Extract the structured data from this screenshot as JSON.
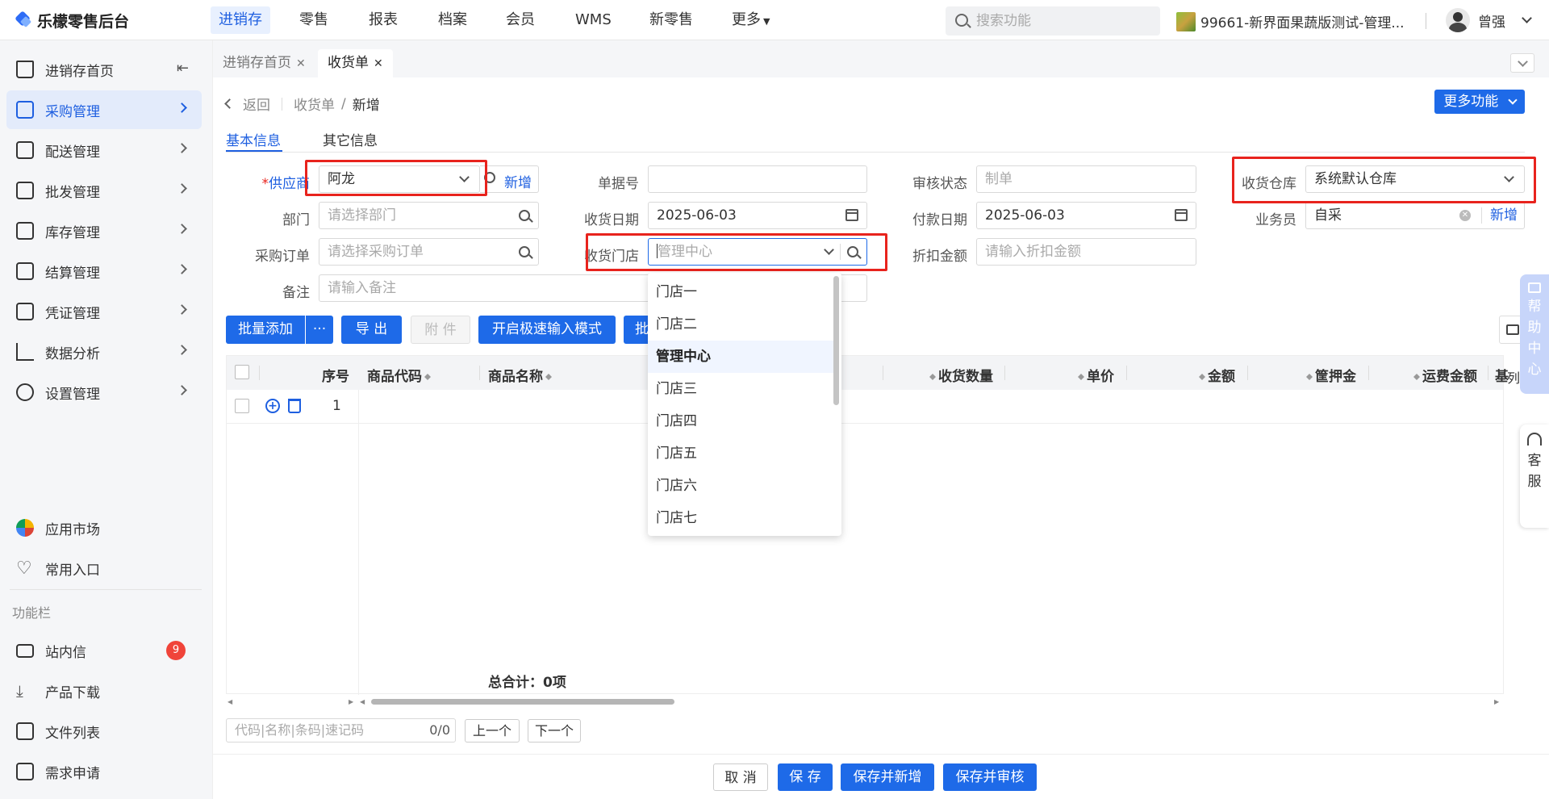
{
  "app": {
    "title": "乐檬零售后台"
  },
  "topnav": {
    "items": [
      "进销存",
      "零售",
      "报表",
      "档案",
      "会员",
      "WMS",
      "新零售",
      "更多"
    ],
    "search_placeholder": "搜索功能",
    "store": "99661-新界面果蔬版测试-管理...",
    "user": "曾强"
  },
  "sidebar": {
    "items": [
      "进销存首页",
      "采购管理",
      "配送管理",
      "批发管理",
      "库存管理",
      "结算管理",
      "凭证管理",
      "数据分析",
      "设置管理"
    ],
    "extra": [
      "应用市场",
      "常用入口"
    ],
    "section": "功能栏",
    "tools": [
      "站内信",
      "产品下载",
      "文件列表",
      "需求申请"
    ],
    "msg_count": "9"
  },
  "pagetabs": [
    "进销存首页",
    "收货单"
  ],
  "breadcrumb": {
    "back": "返回",
    "parent": "收货单",
    "sep": "/",
    "current": "新增"
  },
  "more_button": "更多功能",
  "formtabs": [
    "基本信息",
    "其它信息"
  ],
  "form": {
    "supplier_label": "供应商",
    "supplier_value": "阿龙",
    "supplier_add": "新增",
    "doc_no_label": "单据号",
    "audit_label": "审核状态",
    "audit_placeholder": "制单",
    "warehouse_label": "收货仓库",
    "warehouse_value": "系统默认仓库",
    "dept_label": "部门",
    "dept_placeholder": "请选择部门",
    "recv_date_label": "收货日期",
    "recv_date_value": "2025-06-03",
    "pay_date_label": "付款日期",
    "pay_date_value": "2025-06-03",
    "clerk_label": "业务员",
    "clerk_value": "自采",
    "clerk_add": "新增",
    "po_label": "采购订单",
    "po_placeholder": "请选择采购订单",
    "store_label": "收货门店",
    "store_placeholder": "管理中心",
    "discount_label": "折扣金额",
    "discount_placeholder": "请输入折扣金额",
    "remark_label": "备注",
    "remark_placeholder": "请输入备注"
  },
  "toolbar": {
    "batch_add": "批量添加",
    "more": "···",
    "export": "导 出",
    "attach": "附 件",
    "fast_input": "开启极速输入模式",
    "batch2": "批"
  },
  "grid": {
    "columns": [
      "序号",
      "商品代码",
      "商品名称",
      "收货数量",
      "单价",
      "金额",
      "筐押金",
      "运费金额",
      "基"
    ],
    "row_index": "1",
    "total": "总合计：0项",
    "col_setting": "列"
  },
  "dropdown_options": [
    "门店一",
    "门店二",
    "管理中心",
    "门店三",
    "门店四",
    "门店五",
    "门店六",
    "门店七"
  ],
  "finder": {
    "placeholder": "代码|名称|条码|速记码",
    "count": "0/0",
    "prev": "上一个",
    "next": "下一个"
  },
  "footer": {
    "cancel": "取 消",
    "save": "保 存",
    "save_new": "保存并新增",
    "save_audit": "保存并审核"
  },
  "side_float": {
    "help": [
      "帮",
      "助",
      "中",
      "心"
    ],
    "service": [
      "客",
      "服"
    ]
  }
}
